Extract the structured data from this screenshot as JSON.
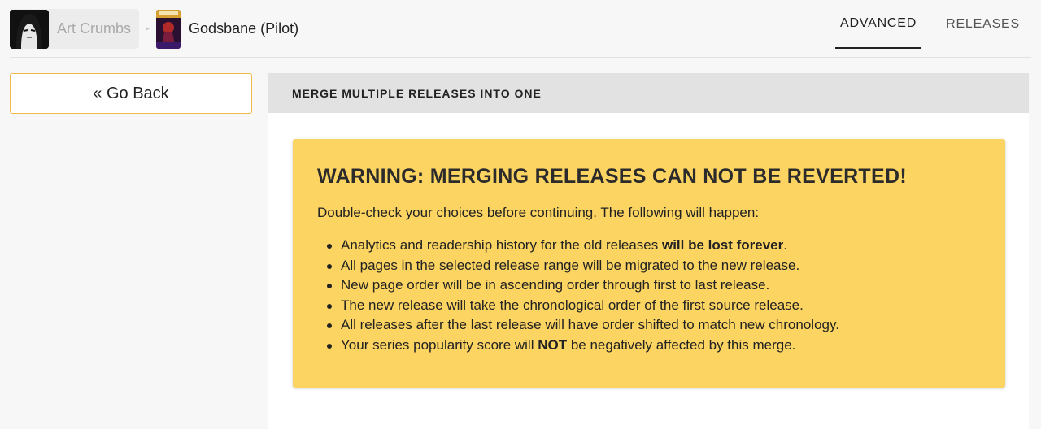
{
  "breadcrumb": {
    "user_name": "Art Crumbs",
    "separator": "▸",
    "series_title": "Godsbane (Pilot)"
  },
  "nav": {
    "tabs": [
      {
        "label": "ADVANCED",
        "active": true
      },
      {
        "label": "RELEASES",
        "active": false
      }
    ]
  },
  "sidebar": {
    "go_back_label": "« Go Back"
  },
  "panel": {
    "title": "MERGE MULTIPLE RELEASES INTO ONE",
    "warning": {
      "title": "WARNING: MERGING RELEASES CAN NOT BE REVERTED!",
      "intro": "Double-check your choices before continuing. The following will happen:",
      "items": [
        {
          "before": "Analytics and readership history for the old releases ",
          "bold": "will be lost forever",
          "after": "."
        },
        {
          "before": "All pages in the selected release range will be migrated to the new release.",
          "bold": "",
          "after": ""
        },
        {
          "before": "New page order will be in ascending order through first to last release.",
          "bold": "",
          "after": ""
        },
        {
          "before": "The new release will take the chronological order of the first source release.",
          "bold": "",
          "after": ""
        },
        {
          "before": "All releases after the last release will have order shifted to match new chronology.",
          "bold": "",
          "after": ""
        },
        {
          "before": "Your series popularity score will ",
          "bold": "NOT",
          "after": " be negatively affected by this merge."
        }
      ]
    }
  },
  "colors": {
    "warning_bg": "#fcd462",
    "go_back_border": "#f0b94a",
    "header_bg": "#e2e2e2"
  }
}
